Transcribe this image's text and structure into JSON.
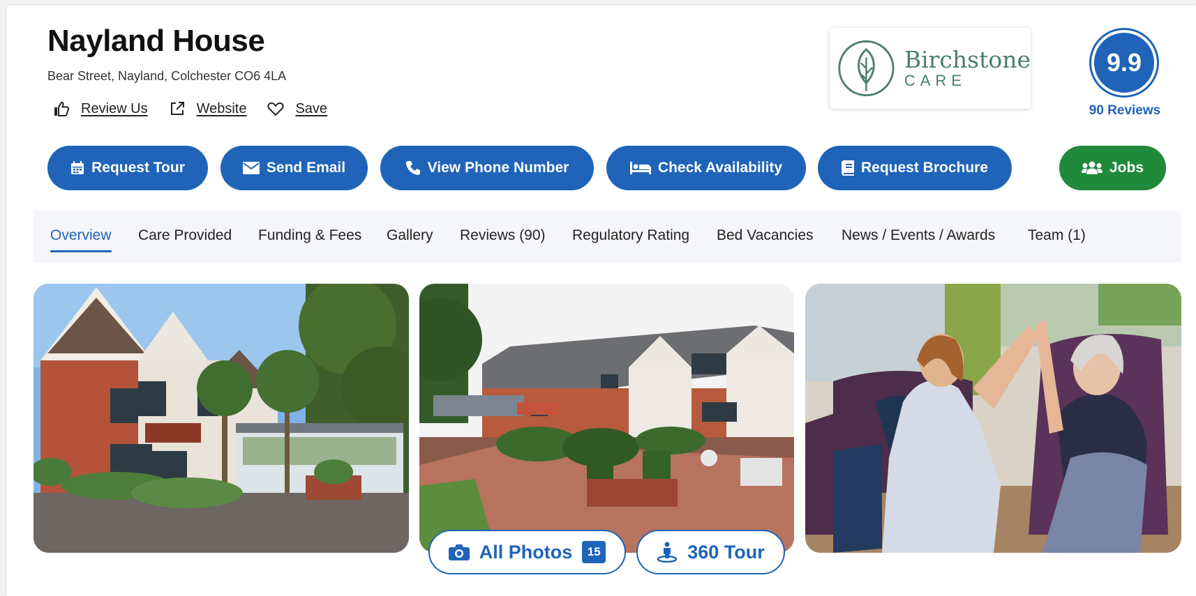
{
  "home": {
    "name": "Nayland House",
    "address": "Bear Street, Nayland, Colchester CO6 4LA"
  },
  "links": {
    "review": "Review Us",
    "website": "Website",
    "save": "Save"
  },
  "brand": {
    "name": "Birchstone",
    "sub": "CARE",
    "color": "#4a7f6b"
  },
  "rating": {
    "score": "9.9",
    "reviews": "90 Reviews"
  },
  "actions": {
    "request_tour": "Request Tour",
    "send_email": "Send Email",
    "view_phone": "View Phone Number",
    "check_availability": "Check Availability",
    "request_brochure": "Request Brochure",
    "jobs": "Jobs"
  },
  "tabs": [
    {
      "label": "Overview",
      "active": true
    },
    {
      "label": "Care Provided"
    },
    {
      "label": "Funding & Fees"
    },
    {
      "label": "Gallery"
    },
    {
      "label": "Reviews (90)"
    },
    {
      "label": "Regulatory Rating"
    },
    {
      "label": "Bed Vacancies"
    },
    {
      "label": "News / Events / Awards"
    },
    {
      "label": "Team (1)"
    }
  ],
  "gallery": {
    "all_photos": "All Photos",
    "photo_count": "15",
    "tour": "360 Tour"
  },
  "colors": {
    "primary": "#1f64b8",
    "jobs": "#1f8a3a"
  }
}
